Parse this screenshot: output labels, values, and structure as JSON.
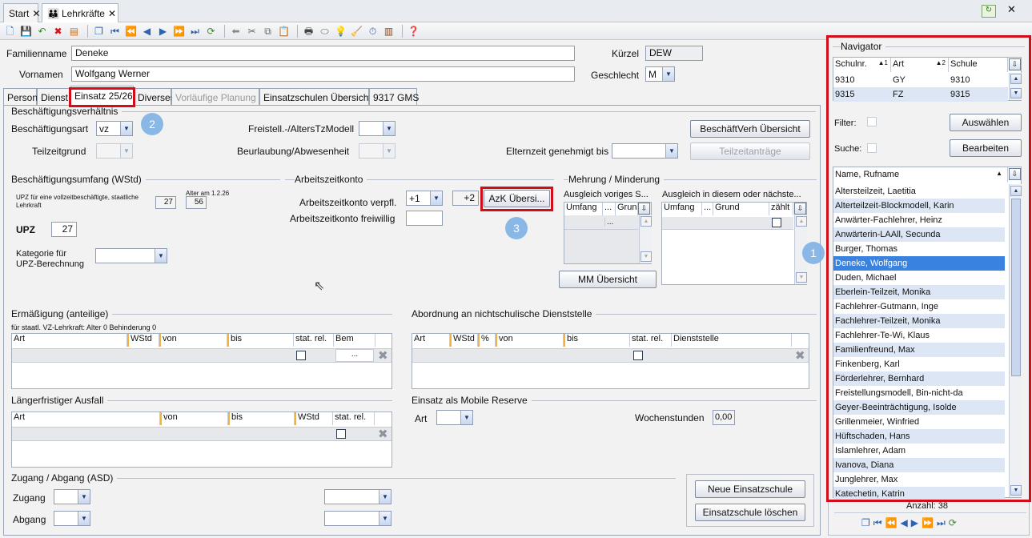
{
  "tabs": {
    "start": "Start",
    "lehrkraefte": "Lehrkräfte"
  },
  "header": {
    "familienname_label": "Familienname",
    "familienname": "Deneke",
    "vornamen_label": "Vornamen",
    "vornamen": "Wolfgang Werner",
    "kuerzel_label": "Kürzel",
    "kuerzel": "DEW",
    "geschlecht_label": "Geschlecht",
    "geschlecht": "M"
  },
  "page_tabs": [
    "Person",
    "Dienst",
    "Einsatz 25/26",
    "Diverses",
    "Vorläufige Planung",
    "Einsatzschulen Übersicht",
    "9317 GMS"
  ],
  "beschaeftigung": {
    "title": "Beschäftigungsverhältnis",
    "art_label": "Beschäftigungsart",
    "art": "vz",
    "teilzeitgrund_label": "Teilzeitgrund",
    "freistell_label": "Freistell.-/AltersTzModell",
    "beurlaubung_label": "Beurlaubung/Abwesenheit",
    "btn_uebersicht": "BeschäftVerh Übersicht",
    "elternzeit_label": "Elternzeit genehmigt bis",
    "btn_teilzeit": "Teilzeitanträge"
  },
  "umfang": {
    "title": "Beschäftigungsumfang (WStd)",
    "upz_vz_label": "UPZ für eine vollzeitbeschäftigte, staatliche Lehrkraft",
    "upz_vz": "27",
    "alter_label": "Alter am 1.2.26",
    "alter": "56",
    "upz_label": "UPZ",
    "upz": "27",
    "kategorie_label": "Kategorie für UPZ-Berechnung"
  },
  "azk": {
    "title": "Arbeitszeitkonto",
    "verpfl_label": "Arbeitszeitkonto verpfl.",
    "verpfl": "+1",
    "verpfl2": "+2",
    "freiwillig_label": "Arbeitszeitkonto freiwillig",
    "btn": "AzK Übersi..."
  },
  "mehrung": {
    "title": "Mehrung / Minderung",
    "ausgleich_vor": "Ausgleich voriges S...",
    "ausgleich_dieses": "Ausgleich in diesem oder nächste...",
    "cols_left": [
      "Umfang",
      "...",
      "Grund"
    ],
    "cols_right": [
      "Umfang",
      "...",
      "Grund",
      "zählt"
    ],
    "btn": "MM Übersicht"
  },
  "ermaessigung": {
    "title": "Ermäßigung (anteilige)",
    "note": "für staatl. VZ-Lehrkraft: Alter 0 Behinderung 0",
    "cols": [
      "Art",
      "WStd",
      "von",
      "bis",
      "stat. rel.",
      "Bem"
    ]
  },
  "abordnung": {
    "title": "Abordnung an nichtschulische Dienststelle",
    "cols": [
      "Art",
      "WStd",
      "%",
      "von",
      "bis",
      "stat. rel.",
      "Dienststelle"
    ]
  },
  "ausfall": {
    "title": "Längerfristiger Ausfall",
    "cols": [
      "Art",
      "von",
      "bis",
      "WStd",
      "stat. rel."
    ]
  },
  "mobile": {
    "title": "Einsatz als Mobile Reserve",
    "art_label": "Art",
    "wochenstunden_label": "Wochenstunden",
    "wochenstunden": "0,00"
  },
  "zugang": {
    "title": "Zugang / Abgang (ASD)",
    "zugang_label": "Zugang",
    "abgang_label": "Abgang"
  },
  "buttons": {
    "neue": "Neue Einsatzschule",
    "loeschen": "Einsatzschule löschen"
  },
  "navigator": {
    "title": "Navigator",
    "cols": [
      "Schulnr.",
      "Art",
      "Schule"
    ],
    "schools": [
      {
        "nr": "9310",
        "art": "GY",
        "schule": "9310"
      },
      {
        "nr": "9315",
        "art": "FZ",
        "schule": "9315"
      }
    ],
    "filter_label": "Filter:",
    "suche_label": "Suche:",
    "btn_auswaehlen": "Auswählen",
    "btn_bearbeiten": "Bearbeiten",
    "list_header": "Name, Rufname",
    "names": [
      "Altersteilzeit, Laetitia",
      "Alterteilzeit-Blockmodell, Karin",
      "Anwärter-Fachlehrer, Heinz",
      "Anwärterin-LAAll, Secunda",
      "Burger, Thomas",
      "Deneke, Wolfgang",
      "Duden, Michael",
      "Eberlein-Teilzeit, Monika",
      "Fachlehrer-Gutmann, Inge",
      "Fachlehrer-Teilzeit, Monika",
      "Fachlehrer-Te-Wi, Klaus",
      "Familienfreund, Max",
      "Finkenberg, Karl",
      "Förderlehrer, Bernhard",
      "Freistellungsmodell, Bin-nicht-da",
      "Geyer-Beeinträchtigung, Isolde",
      "Grillenmeier, Winfried",
      "Hüftschaden, Hans",
      "Islamlehrer, Adam",
      "Ivanova, Diana",
      "Junglehrer, Max",
      "Katechetin, Katrin"
    ],
    "anzahl_label": "Anzahl:",
    "anzahl": "38"
  },
  "bubbles": [
    "1",
    "2",
    "3"
  ]
}
